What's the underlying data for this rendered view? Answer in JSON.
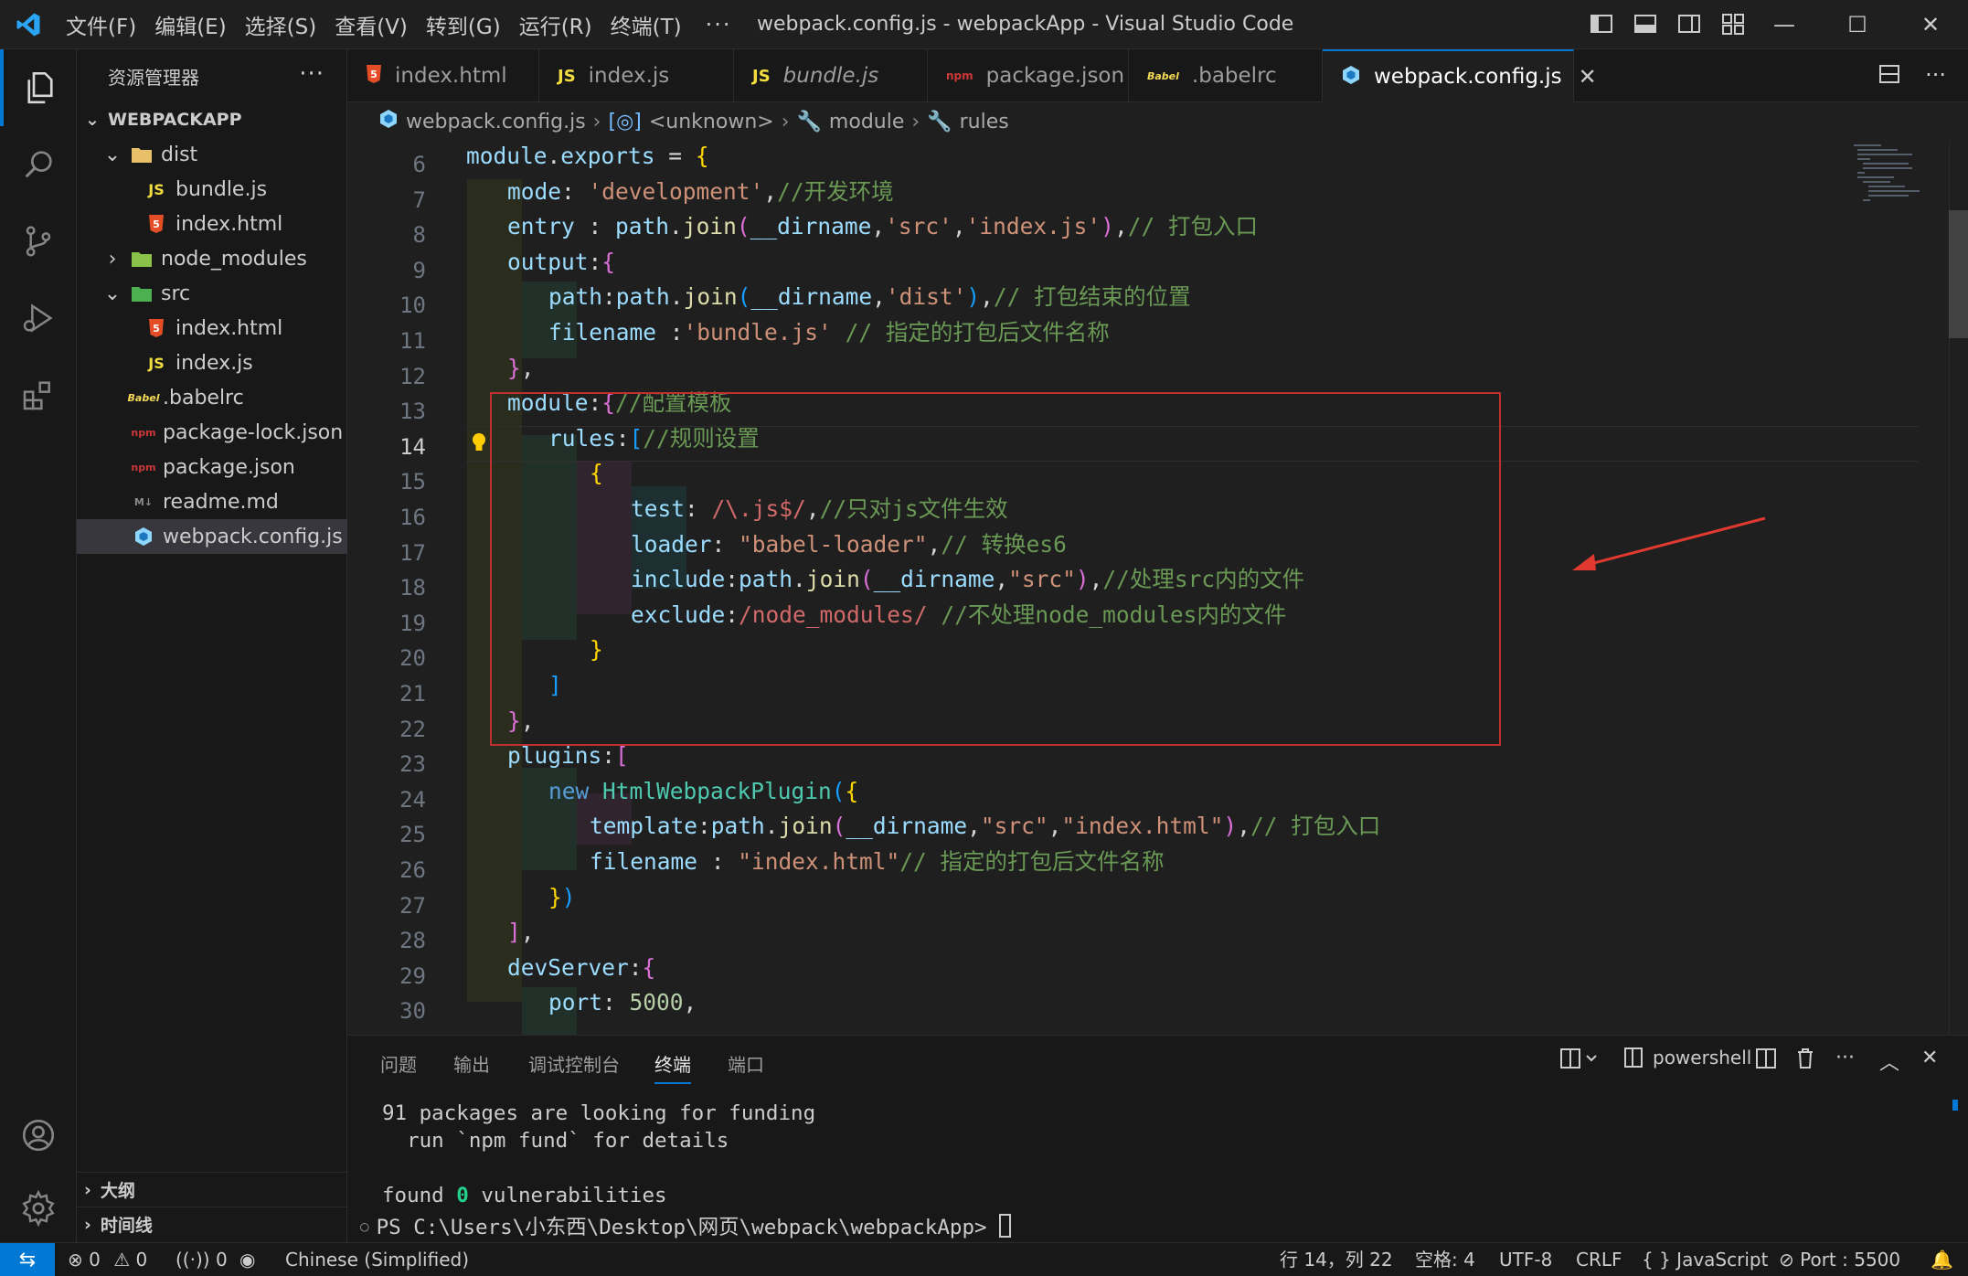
{
  "titlebar": {
    "menu": [
      "文件(F)",
      "编辑(E)",
      "选择(S)",
      "查看(V)",
      "转到(G)",
      "运行(R)",
      "终端(T)"
    ],
    "more": "···",
    "title": "webpack.config.js - webpackApp - Visual Studio Code"
  },
  "sidebar": {
    "title": "资源管理器",
    "more": "···",
    "root": "WEBPACKAPP",
    "items": [
      {
        "label": "dist",
        "icon": "folder-icon"
      },
      {
        "label": "bundle.js",
        "icon": "js-file-icon"
      },
      {
        "label": "index.html",
        "icon": "html-file-icon"
      },
      {
        "label": "node_modules",
        "icon": "folder-icon"
      },
      {
        "label": "src",
        "icon": "folder-icon"
      },
      {
        "label": "index.html",
        "icon": "html-file-icon"
      },
      {
        "label": "index.js",
        "icon": "js-file-icon"
      },
      {
        "label": ".babelrc",
        "icon": "babel-file-icon"
      },
      {
        "label": "package-lock.json",
        "icon": "npm-file-icon"
      },
      {
        "label": "package.json",
        "icon": "npm-file-icon"
      },
      {
        "label": "readme.md",
        "icon": "markdown-file-icon"
      },
      {
        "label": "webpack.config.js",
        "icon": "webpack-file-icon"
      }
    ],
    "outline": "大纲",
    "timeline": "时间线"
  },
  "tabs": [
    {
      "label": "index.html",
      "icon_text": "5"
    },
    {
      "label": "index.js",
      "icon_text": "JS"
    },
    {
      "label": "bundle.js",
      "icon_text": "JS"
    },
    {
      "label": "package.json",
      "icon_text": "npm"
    },
    {
      "label": ".babelrc",
      "icon_text": "Babel"
    },
    {
      "label": "webpack.config.js",
      "icon_text": ""
    }
  ],
  "breadcrumb": [
    "webpack.config.js",
    "<unknown>",
    "module",
    "rules"
  ],
  "editor": {
    "line_numbers": [
      "6",
      "7",
      "8",
      "9",
      "10",
      "11",
      "12",
      "13",
      "14",
      "15",
      "16",
      "17",
      "18",
      "19",
      "20",
      "21",
      "22",
      "23",
      "24",
      "25",
      "26",
      "27",
      "28",
      "29",
      "30"
    ],
    "current_line": "14"
  },
  "panel": {
    "tabs": [
      "问题",
      "输出",
      "调试控制台",
      "终端",
      "端口"
    ],
    "active_tab": "终端",
    "shell": "powershell",
    "terminal": [
      "91 packages are looking for funding",
      "  run `npm fund` for details",
      "",
      "found ",
      "0",
      " vulnerabilities",
      "PS C:\\Users\\小东西\\Desktop\\网页\\webpack\\webpackApp> "
    ]
  },
  "statusbar": {
    "errors": "0",
    "warnings": "0",
    "ports": "0",
    "language_pack": "Chinese (Simplified)",
    "cursor": "行 14，列 22",
    "spaces": "空格: 4",
    "encoding": "UTF-8",
    "eol": "CRLF",
    "language": "JavaScript",
    "port": "Port : 5500"
  },
  "colors": {
    "accent": "#0078d4",
    "highlight_box": "#c0302e",
    "arrow": "#e03a30"
  }
}
